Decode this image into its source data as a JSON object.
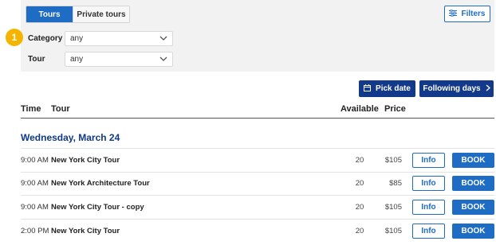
{
  "tabs": {
    "active": "Tours",
    "inactive": "Private tours"
  },
  "filters_button": {
    "label": "Filters",
    "icon": "sliders-icon"
  },
  "step_badge": "1",
  "filters": {
    "category": {
      "label": "Category",
      "value": "any"
    },
    "tour": {
      "label": "Tour",
      "value": "any"
    }
  },
  "actions": {
    "pick_date": {
      "label": "Pick date",
      "icon": "calendar-icon"
    },
    "following_days": {
      "label": "Following days",
      "icon": "chevron-right-icon"
    }
  },
  "table": {
    "headers": {
      "time": "Time",
      "tour": "Tour",
      "available": "Available",
      "price": "Price"
    },
    "date": "Wednesday, March 24",
    "rows": [
      {
        "time": "9:00 AM",
        "tour": "New York City Tour",
        "available": "20",
        "price": "$105",
        "info": "Info",
        "book": "BOOK"
      },
      {
        "time": "9:00 AM",
        "tour": "New York Architecture Tour",
        "available": "20",
        "price": "$85",
        "info": "Info",
        "book": "BOOK"
      },
      {
        "time": "9:00 AM",
        "tour": "New York City Tour - copy",
        "available": "20",
        "price": "$105",
        "info": "Info",
        "book": "BOOK"
      },
      {
        "time": "2:00 PM",
        "tour": "New York City Tour",
        "available": "20",
        "price": "$105",
        "info": "Info",
        "book": "BOOK"
      }
    ]
  },
  "colors": {
    "primary": "#1f6cc5",
    "dark": "#12398a",
    "accent": "#f4b400",
    "panel": "#f2f2f2"
  }
}
